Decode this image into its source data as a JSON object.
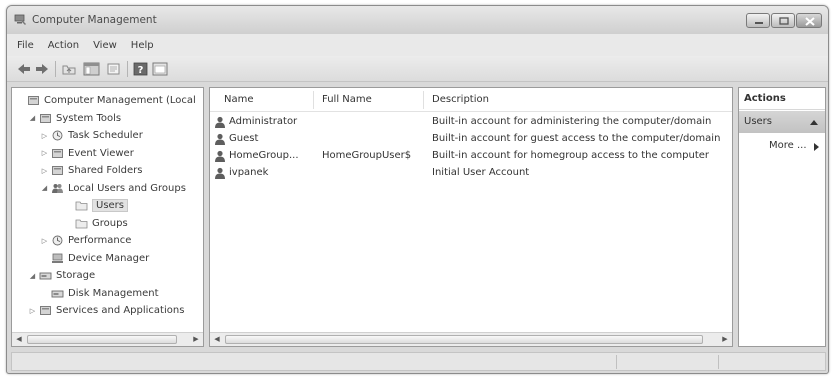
{
  "window": {
    "title": "Computer Management"
  },
  "menubar": {
    "items": [
      "File",
      "Action",
      "View",
      "Help"
    ]
  },
  "toolbar": {
    "buttons": [
      "back-icon",
      "forward-icon",
      "up-folder-icon",
      "show-hide-tree-icon",
      "export-list-icon",
      "help-icon",
      "properties-icon"
    ]
  },
  "tree": {
    "items": [
      {
        "label": "Computer Management (Local",
        "icon": "computer-management-icon",
        "level": 0,
        "twisty": ""
      },
      {
        "label": "System Tools",
        "icon": "tools-icon",
        "level": 1,
        "twisty": "expanded"
      },
      {
        "label": "Task Scheduler",
        "icon": "clock-icon",
        "level": 2,
        "twisty": "collapsed"
      },
      {
        "label": "Event Viewer",
        "icon": "event-viewer-icon",
        "level": 2,
        "twisty": "collapsed"
      },
      {
        "label": "Shared Folders",
        "icon": "shared-folder-icon",
        "level": 2,
        "twisty": "collapsed"
      },
      {
        "label": "Local Users and Groups",
        "icon": "users-groups-icon",
        "level": 2,
        "twisty": "expanded"
      },
      {
        "label": "Users",
        "icon": "folder-icon",
        "level": 3,
        "twisty": "",
        "selected": true
      },
      {
        "label": "Groups",
        "icon": "folder-icon",
        "level": 3,
        "twisty": ""
      },
      {
        "label": "Performance",
        "icon": "performance-icon",
        "level": 2,
        "twisty": "collapsed"
      },
      {
        "label": "Device Manager",
        "icon": "device-manager-icon",
        "level": 2,
        "twisty": ""
      },
      {
        "label": "Storage",
        "icon": "storage-icon",
        "level": 1,
        "twisty": "expanded"
      },
      {
        "label": "Disk Management",
        "icon": "disk-icon",
        "level": 2,
        "twisty": ""
      },
      {
        "label": "Services and Applications",
        "icon": "services-icon",
        "level": 1,
        "twisty": "collapsed"
      }
    ]
  },
  "list": {
    "columns": [
      "Name",
      "Full Name",
      "Description"
    ],
    "rows": [
      {
        "name": "Administrator",
        "full_name": "",
        "description": "Built-in account for administering the computer/domain"
      },
      {
        "name": "Guest",
        "full_name": "",
        "description": "Built-in account for guest access to the computer/domain"
      },
      {
        "name": "HomeGroup...",
        "full_name": "HomeGroupUser$",
        "description": "Built-in account for homegroup access to the computer"
      },
      {
        "name": "ivpanek",
        "full_name": "",
        "description": "Initial User Account"
      }
    ]
  },
  "actions": {
    "title": "Actions",
    "group": "Users",
    "items": [
      "More ..."
    ]
  }
}
